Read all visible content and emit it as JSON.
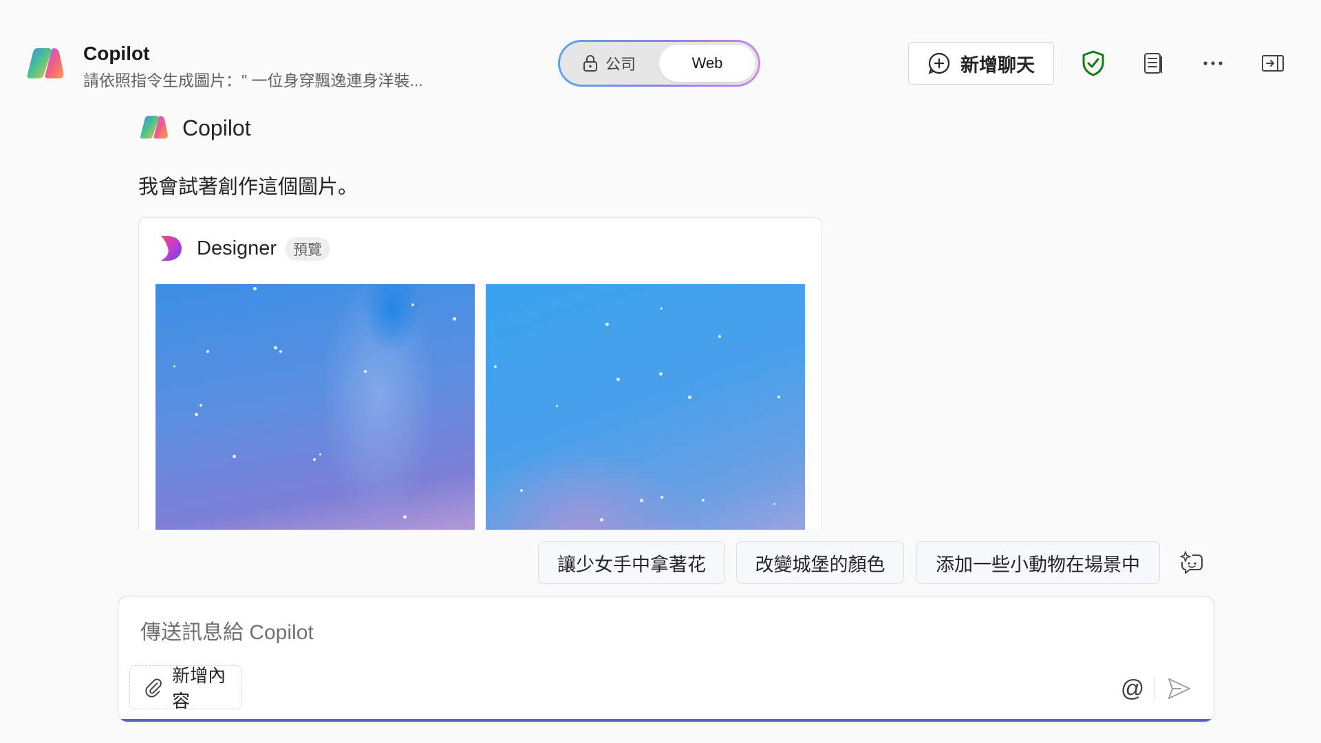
{
  "header": {
    "app_title": "Copilot",
    "subtitle": "請依照指令生成圖片：\" 一位身穿飄逸連身洋裝...",
    "mode_toggle": {
      "work_label": "公司",
      "web_label": "Web",
      "selected": "Web"
    },
    "new_chat_label": "新增聊天",
    "icons": [
      "shield-check-icon",
      "notes-icon",
      "more-icon",
      "side-panel-icon"
    ],
    "shield_color": "#107c10"
  },
  "message": {
    "author": "Copilot",
    "text": "我會試著創作這個圖片。",
    "designer_card": {
      "name": "Designer",
      "badge": "預覽",
      "image_count": 2
    }
  },
  "suggestions": [
    "讓少女手中拿著花",
    "改變城堡的顏色",
    "添加一些小動物在場景中"
  ],
  "composer": {
    "placeholder": "傳送訊息給 Copilot",
    "add_content_label": "新增內容",
    "mention_symbol": "@",
    "accent_color": "#5b5fc7"
  }
}
